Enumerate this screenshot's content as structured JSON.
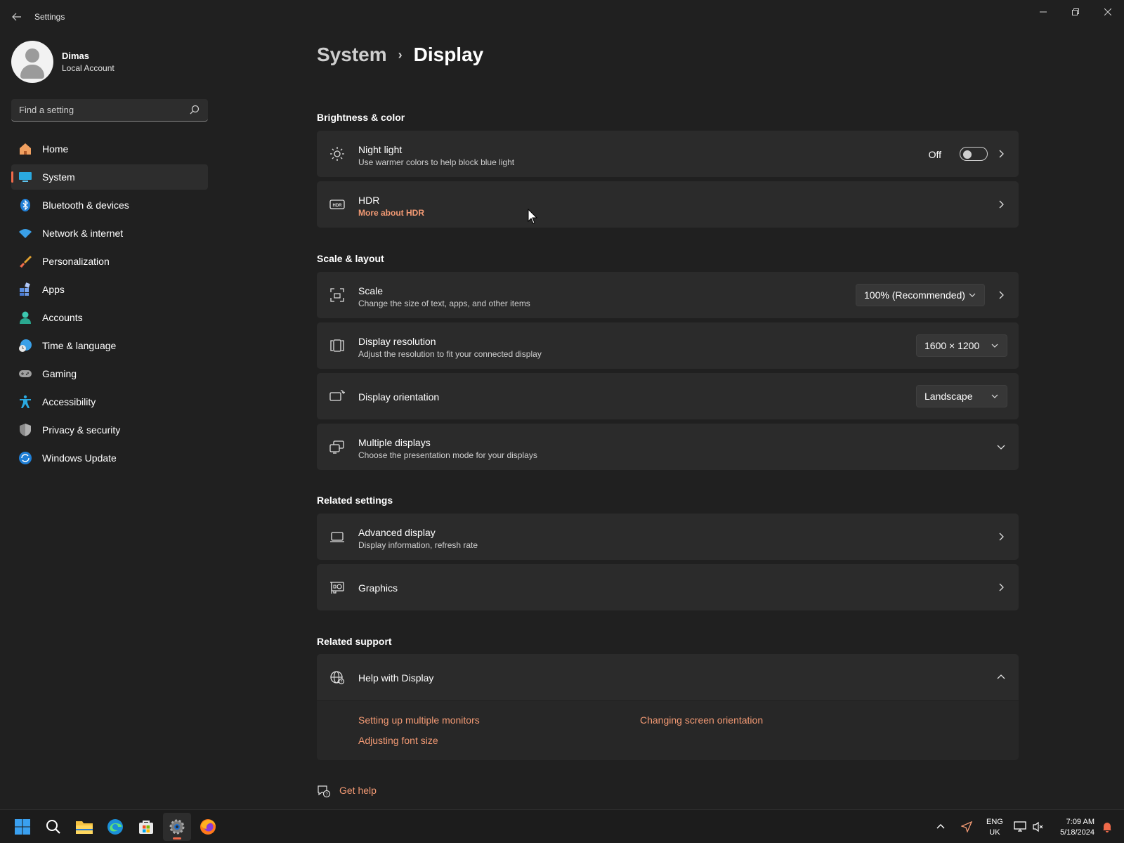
{
  "window": {
    "title": "Settings"
  },
  "user": {
    "name": "Dimas",
    "account_type": "Local Account"
  },
  "search": {
    "placeholder": "Find a setting"
  },
  "sidebar": {
    "items": [
      {
        "label": "Home",
        "icon": "home-icon"
      },
      {
        "label": "System",
        "icon": "system-icon",
        "active": true
      },
      {
        "label": "Bluetooth & devices",
        "icon": "bluetooth-icon"
      },
      {
        "label": "Network & internet",
        "icon": "wifi-icon"
      },
      {
        "label": "Personalization",
        "icon": "brush-icon"
      },
      {
        "label": "Apps",
        "icon": "apps-icon"
      },
      {
        "label": "Accounts",
        "icon": "accounts-icon"
      },
      {
        "label": "Time & language",
        "icon": "time-language-icon"
      },
      {
        "label": "Gaming",
        "icon": "gamepad-icon"
      },
      {
        "label": "Accessibility",
        "icon": "accessibility-icon"
      },
      {
        "label": "Privacy & security",
        "icon": "shield-icon"
      },
      {
        "label": "Windows Update",
        "icon": "update-icon"
      }
    ]
  },
  "breadcrumb": {
    "parent": "System",
    "current": "Display"
  },
  "sections": {
    "brightness": {
      "title": "Brightness & color",
      "night_light": {
        "title": "Night light",
        "subtitle": "Use warmer colors to help block blue light",
        "state_label": "Off",
        "enabled": false
      },
      "hdr": {
        "title": "HDR",
        "link": "More about HDR"
      }
    },
    "scale_layout": {
      "title": "Scale & layout",
      "scale": {
        "title": "Scale",
        "subtitle": "Change the size of text, apps, and other items",
        "value": "100% (Recommended)"
      },
      "resolution": {
        "title": "Display resolution",
        "subtitle": "Adjust the resolution to fit your connected display",
        "value": "1600 × 1200"
      },
      "orientation": {
        "title": "Display orientation",
        "value": "Landscape"
      },
      "multiple": {
        "title": "Multiple displays",
        "subtitle": "Choose the presentation mode for your displays"
      }
    },
    "related_settings": {
      "title": "Related settings",
      "advanced": {
        "title": "Advanced display",
        "subtitle": "Display information, refresh rate"
      },
      "graphics": {
        "title": "Graphics"
      }
    },
    "related_support": {
      "title": "Related support",
      "help": {
        "title": "Help with Display"
      },
      "links": [
        "Setting up multiple monitors",
        "Changing screen orientation",
        "Adjusting font size"
      ]
    }
  },
  "get_help": {
    "label": "Get help"
  },
  "taskbar": {
    "apps": [
      "start-icon",
      "search-icon",
      "file-explorer-icon",
      "edge-icon",
      "store-icon",
      "settings-icon",
      "firefox-icon"
    ],
    "language": {
      "line1": "ENG",
      "line2": "UK"
    },
    "clock": {
      "time": "7:09 AM",
      "date": "5/18/2024"
    }
  },
  "colors": {
    "accent": "#f06a4a",
    "link": "#f39a74",
    "background": "#202020",
    "card": "#2b2b2b"
  }
}
